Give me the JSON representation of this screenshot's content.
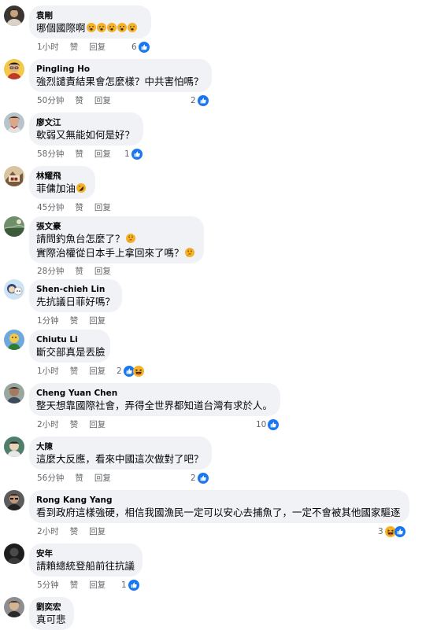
{
  "labels": {
    "like": "赞",
    "reply": "回复"
  },
  "comments": [
    {
      "name": "袁剛",
      "lines": [
        "哪個國際啊"
      ],
      "time": "1小时",
      "count": "6"
    },
    {
      "name": "Pingling Ho",
      "lines": [
        "強烈譴責結果會怎麼樣？中共害怕嗎？"
      ],
      "time": "50分钟",
      "count": "2"
    },
    {
      "name": "廖文江",
      "lines": [
        "軟弱又無能如何是好？"
      ],
      "time": "58分钟",
      "count": "1"
    },
    {
      "name": "林耀飛",
      "lines": [
        "菲傭加油"
      ],
      "time": "45分钟",
      "count": ""
    },
    {
      "name": "張文豪",
      "lines": [
        "請問釣魚台怎麼了？",
        "實際治權從日本手上拿回來了嗎？"
      ],
      "time": "28分钟",
      "count": ""
    },
    {
      "name": "Shen-chieh Lin",
      "lines": [
        "先抗議日菲好嗎？"
      ],
      "time": "1分钟",
      "count": ""
    },
    {
      "name": "Chiutu Li",
      "lines": [
        "斷交部真是丟臉"
      ],
      "time": "1小时",
      "count": "2"
    },
    {
      "name": "Cheng Yuan Chen",
      "lines": [
        "整天想靠國際社會，弄得全世界都知道台灣有求於人。"
      ],
      "time": "2小时",
      "count": "10"
    },
    {
      "name": "大陳",
      "lines": [
        "這麼大反應，看來中國這次做對了吧？"
      ],
      "time": "56分钟",
      "count": "2"
    },
    {
      "name": "Rong Kang Yang",
      "lines": [
        "看到政府這樣強硬，相信我國漁民一定可以安心去捕魚了，一定不會被其他國家驅逐"
      ],
      "time": "2小时",
      "count": "3"
    },
    {
      "name": "安年",
      "lines": [
        "請賴總統登船前往抗議"
      ],
      "time": "5分钟",
      "count": "1"
    },
    {
      "name": "劉奕宏",
      "lines": [
        "真可悲"
      ],
      "time": "",
      "count": ""
    }
  ],
  "colors": {
    "like_blue": "#1877f2",
    "bubble_bg": "#f0f2f5",
    "meta_gray": "#65676b",
    "haha_yellow": "#f7b125"
  }
}
